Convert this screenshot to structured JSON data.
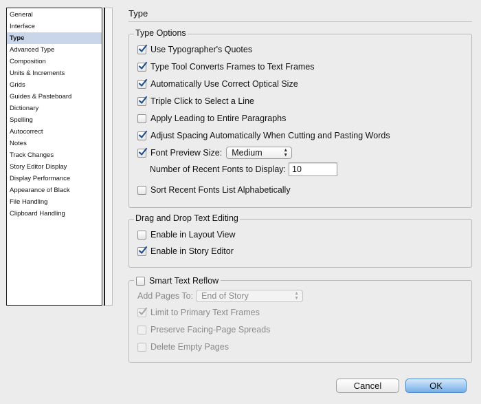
{
  "sidebar": {
    "items": [
      {
        "label": "General"
      },
      {
        "label": "Interface"
      },
      {
        "label": "Type",
        "selected": true
      },
      {
        "label": "Advanced Type"
      },
      {
        "label": "Composition"
      },
      {
        "label": "Units & Increments"
      },
      {
        "label": "Grids"
      },
      {
        "label": "Guides & Pasteboard"
      },
      {
        "label": "Dictionary"
      },
      {
        "label": "Spelling"
      },
      {
        "label": "Autocorrect"
      },
      {
        "label": "Notes"
      },
      {
        "label": "Track Changes"
      },
      {
        "label": "Story Editor Display"
      },
      {
        "label": "Display Performance"
      },
      {
        "label": "Appearance of Black"
      },
      {
        "label": "File Handling"
      },
      {
        "label": "Clipboard Handling"
      }
    ]
  },
  "panel": {
    "title": "Type"
  },
  "type_options": {
    "legend": "Type Options",
    "use_typographers_quotes": {
      "label": "Use Typographer's Quotes",
      "checked": true
    },
    "type_tool_converts": {
      "label": "Type Tool Converts Frames to Text Frames",
      "checked": true
    },
    "optical_size": {
      "label": "Automatically Use Correct Optical Size",
      "checked": true
    },
    "triple_click": {
      "label": "Triple Click to Select a Line",
      "checked": true
    },
    "apply_leading": {
      "label": "Apply Leading to Entire Paragraphs",
      "checked": false
    },
    "adjust_spacing": {
      "label": "Adjust Spacing Automatically When Cutting and Pasting Words",
      "checked": true
    },
    "font_preview": {
      "label": "Font Preview Size:",
      "checked": true,
      "value": "Medium"
    },
    "recent_fonts": {
      "label": "Number of Recent Fonts to Display:",
      "value": "10"
    },
    "sort_recent": {
      "label": "Sort Recent Fonts List Alphabetically",
      "checked": false
    }
  },
  "drag_drop": {
    "legend": "Drag and Drop Text Editing",
    "layout_view": {
      "label": "Enable in Layout View",
      "checked": false
    },
    "story_editor": {
      "label": "Enable in Story Editor",
      "checked": true
    }
  },
  "smart_reflow": {
    "legend": "Smart Text Reflow",
    "checked": false,
    "add_pages_label": "Add Pages To:",
    "add_pages_value": "End of Story",
    "limit_primary": {
      "label": "Limit to Primary Text Frames",
      "checked": true
    },
    "preserve_facing": {
      "label": "Preserve Facing-Page Spreads",
      "checked": false
    },
    "delete_empty": {
      "label": "Delete Empty Pages",
      "checked": false
    }
  },
  "buttons": {
    "cancel": "Cancel",
    "ok": "OK"
  },
  "colors": {
    "selection": "#c9d6e9",
    "ok_button": "#74aee8",
    "checkmark": "#1f4f8f"
  }
}
